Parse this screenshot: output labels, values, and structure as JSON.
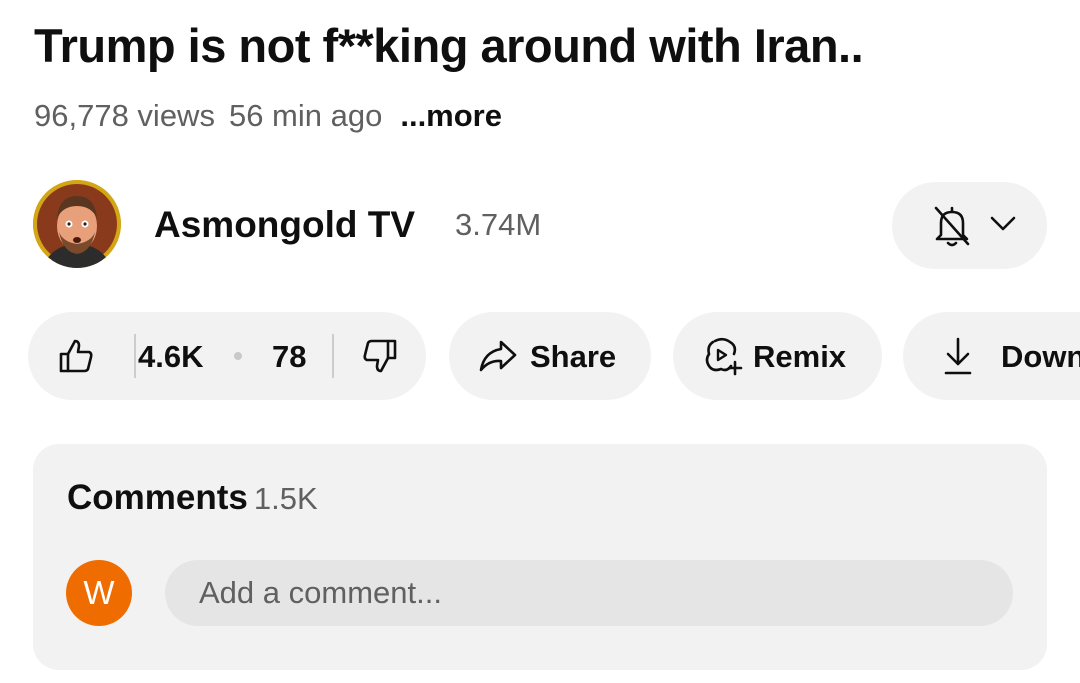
{
  "video": {
    "title": "Trump is not f**king around with Iran..",
    "views": "96,778 views",
    "age": "56 min ago",
    "more_label": "...more"
  },
  "channel": {
    "name": "Asmongold TV",
    "subscribers": "3.74M",
    "bell_icon": "bell-off-icon"
  },
  "actions": {
    "likes": "4.6K",
    "dislikes": "78",
    "share_label": "Share",
    "remix_label": "Remix",
    "download_label": "Down"
  },
  "comments": {
    "label": "Comments",
    "count": "1.5K",
    "user_initial": "W",
    "placeholder": "Add a comment..."
  },
  "colors": {
    "pill_bg": "#f2f2f2",
    "secondary_text": "#606060",
    "user_avatar": "#ef6c00",
    "avatar_ring": "#c8a000"
  }
}
